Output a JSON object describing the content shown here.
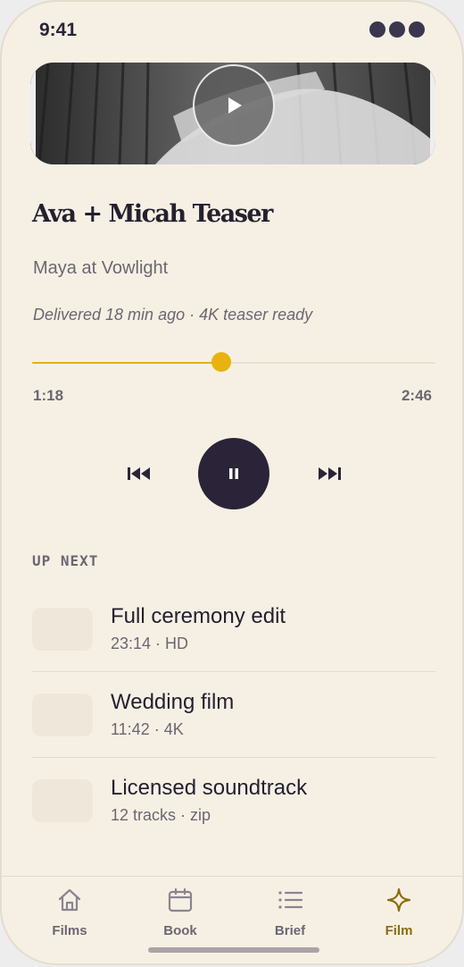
{
  "status": {
    "time": "9:41"
  },
  "video": {
    "play_icon": "play-icon"
  },
  "film": {
    "title": "Ava + Micah Teaser",
    "studio": "Maya at Vowlight",
    "delivered": "Delivered 18 min ago · 4K teaser ready"
  },
  "player": {
    "current_time": "1:18",
    "total_time": "2:46",
    "progress": 0.47
  },
  "up_next": {
    "heading": "UP NEXT",
    "items": [
      {
        "title": "Full ceremony edit",
        "meta": "23:14 · HD"
      },
      {
        "title": "Wedding film",
        "meta": "11:42 · 4K"
      },
      {
        "title": "Licensed soundtrack",
        "meta": "12 tracks · zip"
      }
    ]
  },
  "tabs": [
    {
      "label": "Films",
      "icon": "house-icon"
    },
    {
      "label": "Book",
      "icon": "calendar-icon"
    },
    {
      "label": "Brief",
      "icon": "list-icon"
    },
    {
      "label": "Film",
      "icon": "sparkle-icon",
      "active": true
    }
  ],
  "colors": {
    "accent": "#e8b30f",
    "background": "#f6f0e4",
    "dark": "#2b2438",
    "active_tab": "#8a6d0c"
  }
}
